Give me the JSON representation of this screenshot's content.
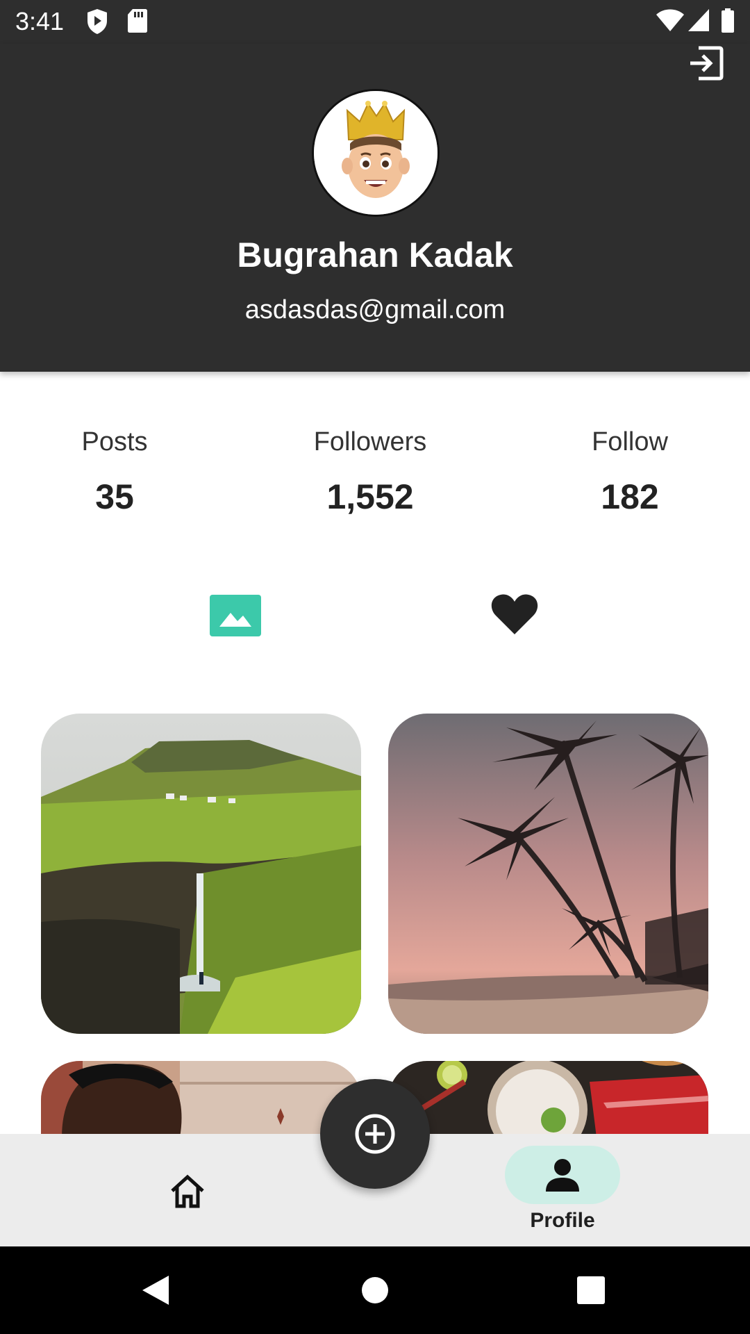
{
  "status_bar": {
    "time": "3:41",
    "left_icons": [
      "shield-play-icon",
      "sd-card-icon"
    ],
    "right_icons": [
      "wifi-icon",
      "signal-icon",
      "battery-icon"
    ]
  },
  "header": {
    "logout_icon": "logout-icon",
    "avatar_icon": "memoji-crown-avatar",
    "name": "Bugrahan Kadak",
    "email": "asdasdas@gmail.com"
  },
  "stats": [
    {
      "label": "Posts",
      "value": "35"
    },
    {
      "label": "Followers",
      "value": "1,552"
    },
    {
      "label": "Follow",
      "value": "182"
    }
  ],
  "tabs": [
    {
      "icon": "image-icon",
      "active": true
    },
    {
      "icon": "heart-icon",
      "active": false
    }
  ],
  "posts": [
    {
      "subject": "waterfall-cliffs"
    },
    {
      "subject": "palm-beach-sunset"
    },
    {
      "subject": "man-portrait"
    },
    {
      "subject": "food-bowl"
    }
  ],
  "bottom_nav": {
    "items": [
      {
        "icon": "home-icon",
        "label": ""
      },
      {
        "icon": "person-icon",
        "label": "Profile"
      }
    ],
    "fab_icon": "add-circle-icon"
  },
  "colors": {
    "header_bg": "#2e2e2e",
    "accent": "#3cc9aa",
    "nav_bg": "#ececec",
    "pill_bg": "#cdeee6"
  }
}
